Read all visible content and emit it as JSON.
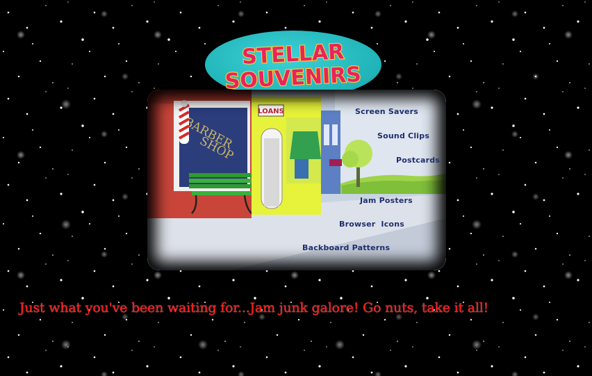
{
  "logo": {
    "line1": "STELLAR",
    "line2": "SOUVENIRS"
  },
  "scene": {
    "shop_sign_line1": "BARBER",
    "shop_sign_line2": "SHOP",
    "loans_sign": "LOANS"
  },
  "menu": [
    {
      "label": "Screen Savers"
    },
    {
      "label": "Sound Clips"
    },
    {
      "label": "Postcards"
    },
    {
      "label": "Jam Posters"
    },
    {
      "label": "Browser  Icons"
    },
    {
      "label": "Backboard Patterns"
    }
  ],
  "tagline": "Just what you've been waiting for...Jam junk galore! Go nuts, take it all!",
  "colors": {
    "background": "#000000",
    "logo_oval": "#20b3b8",
    "logo_text": "#e8245c",
    "menu_text": "#1f2f6e",
    "tagline": "#ff1a1a"
  }
}
